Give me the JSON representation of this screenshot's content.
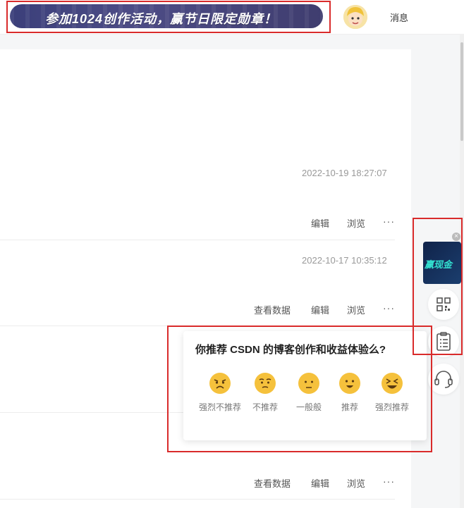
{
  "header": {
    "banner_text": "参加1024创作活动，赢节日限定勋章！",
    "messages_label": "消息"
  },
  "articles": [
    {
      "time": "2022-10-19 18:27:07",
      "actions": [
        "编辑",
        "浏览"
      ]
    },
    {
      "time": "2022-10-17 10:35:12",
      "actions": [
        "查看数据",
        "编辑",
        "浏览"
      ]
    },
    {
      "time": "",
      "actions": [
        "查看数据",
        "编辑",
        "浏览"
      ]
    }
  ],
  "more_label": "···",
  "sidebar": {
    "ad_text": "赢现金",
    "tools": [
      "qrcode-icon",
      "clipboard-icon",
      "headset-icon"
    ]
  },
  "feedback": {
    "question": "你推荐 CSDN 的博客创作和收益体验么?",
    "options": [
      "强烈不推荐",
      "不推荐",
      "一般般",
      "推荐",
      "强烈推荐"
    ]
  },
  "colors": {
    "highlight": "#d92b2b",
    "emoji": "#f5c13c"
  }
}
